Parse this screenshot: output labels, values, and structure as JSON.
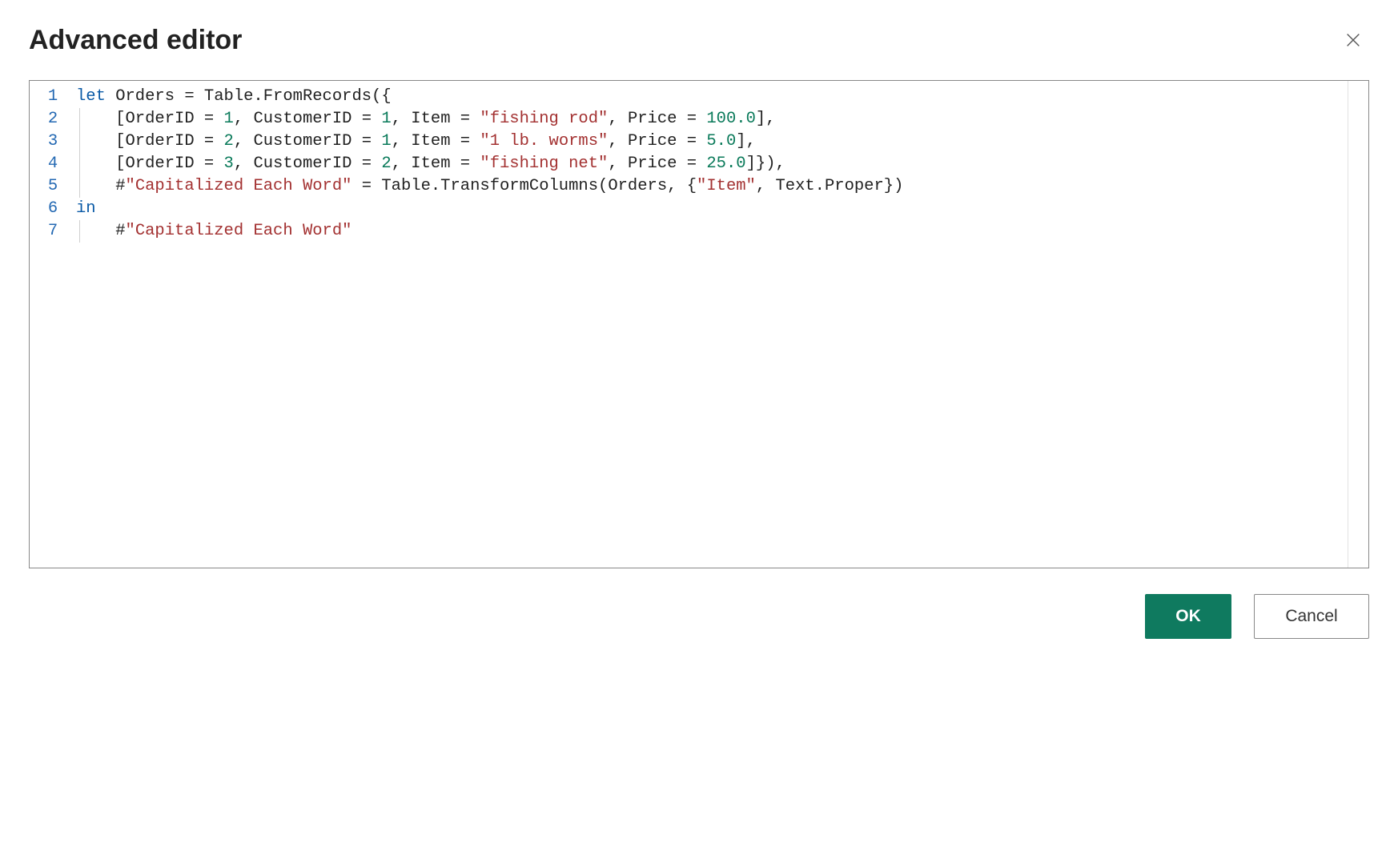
{
  "header": {
    "title": "Advanced editor"
  },
  "editor": {
    "line_numbers": [
      "1",
      "2",
      "3",
      "4",
      "5",
      "6",
      "7"
    ],
    "lines": [
      {
        "indent": 0,
        "tokens": [
          {
            "k": "kw",
            "t": "let"
          },
          {
            "k": "pl",
            "t": " Orders = Table.FromRecords({"
          }
        ]
      },
      {
        "indent": 1,
        "tokens": [
          {
            "k": "pl",
            "t": "    [OrderID = "
          },
          {
            "k": "num",
            "t": "1"
          },
          {
            "k": "pl",
            "t": ", CustomerID = "
          },
          {
            "k": "num",
            "t": "1"
          },
          {
            "k": "pl",
            "t": ", Item = "
          },
          {
            "k": "str",
            "t": "\"fishing rod\""
          },
          {
            "k": "pl",
            "t": ", Price = "
          },
          {
            "k": "num",
            "t": "100.0"
          },
          {
            "k": "pl",
            "t": "],"
          }
        ]
      },
      {
        "indent": 1,
        "tokens": [
          {
            "k": "pl",
            "t": "    [OrderID = "
          },
          {
            "k": "num",
            "t": "2"
          },
          {
            "k": "pl",
            "t": ", CustomerID = "
          },
          {
            "k": "num",
            "t": "1"
          },
          {
            "k": "pl",
            "t": ", Item = "
          },
          {
            "k": "str",
            "t": "\"1 lb. worms\""
          },
          {
            "k": "pl",
            "t": ", Price = "
          },
          {
            "k": "num",
            "t": "5.0"
          },
          {
            "k": "pl",
            "t": "],"
          }
        ]
      },
      {
        "indent": 1,
        "tokens": [
          {
            "k": "pl",
            "t": "    [OrderID = "
          },
          {
            "k": "num",
            "t": "3"
          },
          {
            "k": "pl",
            "t": ", CustomerID = "
          },
          {
            "k": "num",
            "t": "2"
          },
          {
            "k": "pl",
            "t": ", Item = "
          },
          {
            "k": "str",
            "t": "\"fishing net\""
          },
          {
            "k": "pl",
            "t": ", Price = "
          },
          {
            "k": "num",
            "t": "25.0"
          },
          {
            "k": "pl",
            "t": "]}),"
          }
        ]
      },
      {
        "indent": 1,
        "tokens": [
          {
            "k": "pl",
            "t": "    #"
          },
          {
            "k": "str",
            "t": "\"Capitalized Each Word\""
          },
          {
            "k": "pl",
            "t": " = Table.TransformColumns(Orders, {"
          },
          {
            "k": "str",
            "t": "\"Item\""
          },
          {
            "k": "pl",
            "t": ", Text.Proper})"
          }
        ]
      },
      {
        "indent": 0,
        "tokens": [
          {
            "k": "kw",
            "t": "in"
          }
        ]
      },
      {
        "indent": 1,
        "tokens": [
          {
            "k": "pl",
            "t": "    #"
          },
          {
            "k": "str",
            "t": "\"Capitalized Each Word\""
          }
        ]
      }
    ]
  },
  "footer": {
    "ok_label": "OK",
    "cancel_label": "Cancel"
  }
}
